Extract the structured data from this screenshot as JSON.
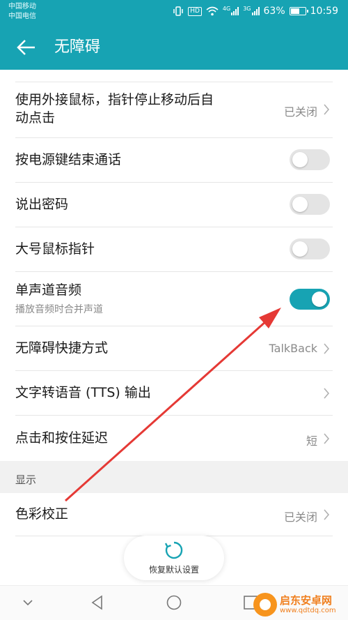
{
  "status_bar": {
    "carrier_1": "中国移动",
    "carrier_2": "中国电信",
    "hd": "HD",
    "net_1": "4G",
    "net_2": "3G",
    "battery": "63%",
    "battery_level": 0.63,
    "time": "10:59"
  },
  "app_bar": {
    "title": "无障碍"
  },
  "rows": [
    {
      "title_line1": "使用外接鼠标，指针停止移动后自",
      "title_line2": "动点击",
      "value": "已关闭"
    },
    {
      "title": "按电源键结束通话",
      "toggle_on": false
    },
    {
      "title": "说出密码",
      "toggle_on": false
    },
    {
      "title": "大号鼠标指针",
      "toggle_on": false
    },
    {
      "title": "单声道音频",
      "subtitle": "播放音频时合并声道",
      "toggle_on": true
    },
    {
      "title": "无障碍快捷方式",
      "value": "TalkBack"
    },
    {
      "title": "文字转语音 (TTS) 输出"
    },
    {
      "title": "点击和按住延迟",
      "value": "短"
    }
  ],
  "section_display": {
    "label": "显示"
  },
  "color_row": {
    "title": "色彩校正",
    "value": "已关闭"
  },
  "restore": {
    "label": "恢复默认设置"
  },
  "watermark": {
    "name": "启东安卓网",
    "url": "www.qdtdq.com"
  },
  "colors": {
    "accent": "#17a3b3",
    "arrow": "#e53935"
  }
}
